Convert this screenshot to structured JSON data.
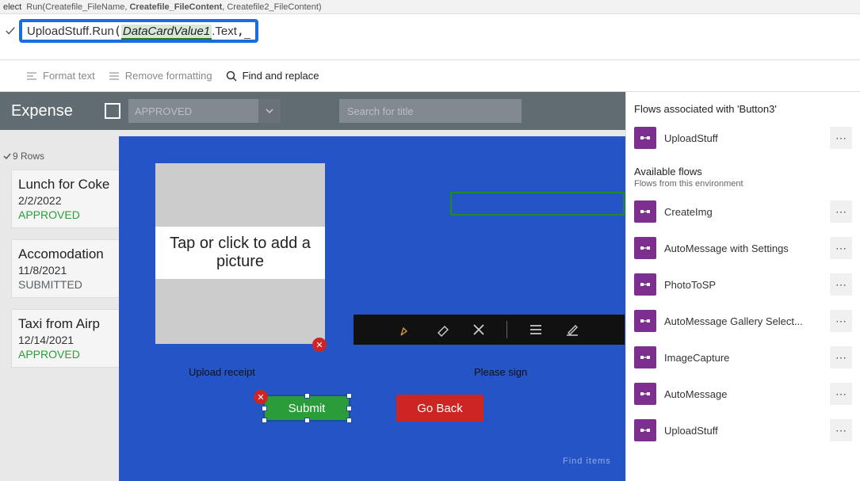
{
  "signature": {
    "prefix": "Run(Createfile_FileName,",
    "bold": "Createfile_FileContent",
    "suffix": ", Createfile2_FileContent)"
  },
  "formula": {
    "left_label": "elect",
    "part1": "UploadStuff",
    "method": "Run",
    "param": "DataCardValue1",
    "prop": "Text"
  },
  "toolbar": {
    "format": "Format text",
    "remove": "Remove formatting",
    "find": "Find and replace"
  },
  "expense": {
    "title": "Expense",
    "approved": "APPROVED",
    "search_placeholder": "Search for title",
    "rows": "9 Rows"
  },
  "list": [
    {
      "title": "Lunch for Coke",
      "date": "2/2/2022",
      "status": "APPROVED",
      "cls": "approved"
    },
    {
      "title": "Accomodation",
      "date": "11/8/2021",
      "status": "SUBMITTED",
      "cls": "submitted"
    },
    {
      "title": "Taxi from Airp",
      "date": "12/14/2021",
      "status": "APPROVED",
      "cls": "approved"
    }
  ],
  "panel": {
    "tap": "Tap or click to add a picture",
    "upload_label": "Upload receipt",
    "sign_label": "Please sign",
    "submit": "Submit",
    "goback": "Go Back",
    "find_items": "Find items"
  },
  "flows": {
    "assoc_title": "Flows associated with 'Button3'",
    "assoc": [
      "UploadStuff"
    ],
    "avail_title": "Available flows",
    "avail_sub": "Flows from this environment",
    "avail": [
      "CreateImg",
      "AutoMessage with Settings",
      "PhotoToSP",
      "AutoMessage Gallery Select...",
      "ImageCapture",
      "AutoMessage",
      "UploadStuff"
    ]
  }
}
